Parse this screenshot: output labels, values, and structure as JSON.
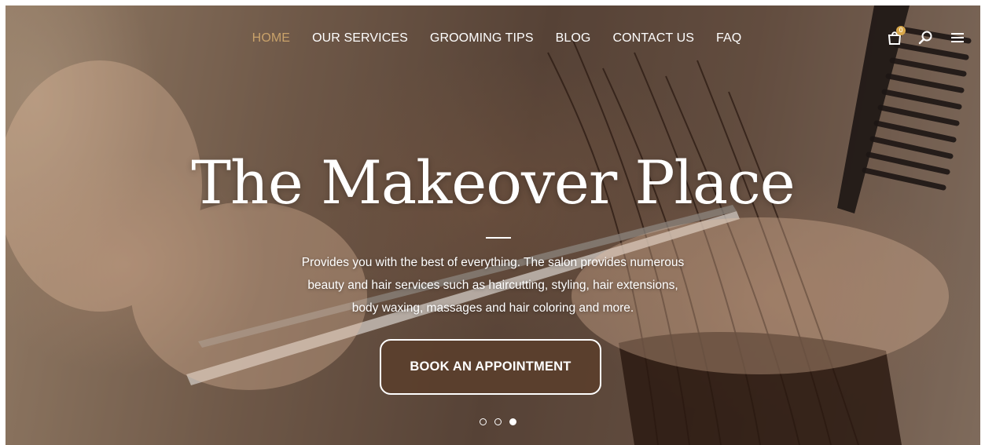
{
  "nav": {
    "items": [
      {
        "label": "HOME",
        "active": true
      },
      {
        "label": "OUR SERVICES",
        "active": false
      },
      {
        "label": "GROOMING TIPS",
        "active": false
      },
      {
        "label": "BLOG",
        "active": false
      },
      {
        "label": "CONTACT US",
        "active": false
      },
      {
        "label": "FAQ",
        "active": false
      }
    ],
    "cart_count": "0",
    "icons": [
      "shopping-bag-icon",
      "search-icon",
      "menu-icon"
    ]
  },
  "hero": {
    "title": "The Makeover Place",
    "description": "Provides you with the best of everything. The salon provides numerous beauty and hair services such as haircutting, styling, hair extensions, body waxing, massages and hair coloring and more.",
    "cta_label": "BOOK AN APPOINTMENT",
    "slides_total": 3,
    "active_slide": 3
  },
  "colors": {
    "accent": "#c9a26a",
    "badge": "#d9a84a",
    "button_bg": "#5a3e2c",
    "text": "#ffffff"
  }
}
